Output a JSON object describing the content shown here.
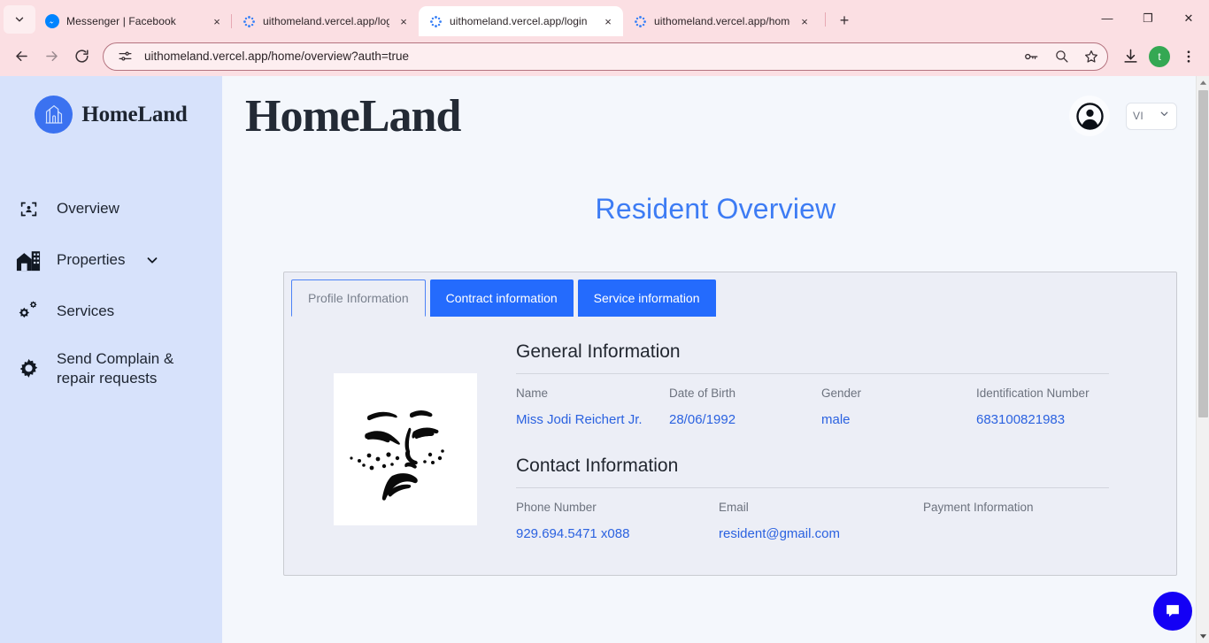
{
  "browser": {
    "tab_search_icon": "chevron-down-icon",
    "tabs": [
      {
        "title": "Messenger | Facebook",
        "favicon": "messenger-icon",
        "close": "×",
        "active": false
      },
      {
        "title": "uithomeland.vercel.app/login",
        "favicon": "vercel-app-icon",
        "close": "×",
        "active": false
      },
      {
        "title": "uithomeland.vercel.app/login",
        "favicon": "vercel-app-icon",
        "close": "×",
        "active": true
      },
      {
        "title": "uithomeland.vercel.app/home/c",
        "favicon": "vercel-app-icon",
        "close": "×",
        "active": false
      }
    ],
    "new_tab_label": "+",
    "window_controls": {
      "minimize": "—",
      "maximize": "❐",
      "close": "✕"
    },
    "toolbar": {
      "back_icon": "arrow-back-icon",
      "forward_icon": "arrow-forward-icon",
      "reload_icon": "reload-icon",
      "site_info_icon": "site-settings-icon",
      "url": "uithomeland.vercel.app/home/overview?auth=true",
      "password_icon": "password-key-icon",
      "zoom_icon": "zoom-search-icon",
      "bookmark_icon": "star-bookmark-icon",
      "download_icon": "download-icon",
      "profile_initial": "t",
      "menu_icon": "three-dot-menu-icon"
    }
  },
  "sidebar": {
    "brand": {
      "name": "HomeLand",
      "logo_icon": "homeland-building-logo"
    },
    "items": [
      {
        "label": "Overview",
        "icon": "overview-scan-icon",
        "has_chevron": false
      },
      {
        "label": "Properties",
        "icon": "properties-building-icon",
        "has_chevron": true,
        "chevron_icon": "chevron-down-icon"
      },
      {
        "label": "Services",
        "icon": "services-gears-icon",
        "has_chevron": false
      },
      {
        "label": "Send Complain & repair requests",
        "icon": "settings-gear-icon",
        "has_chevron": false
      }
    ]
  },
  "header": {
    "wordmark": "HomeLand",
    "account_icon": "account-circle-icon",
    "language": {
      "value": "VI",
      "chevron_icon": "chevron-down-icon"
    }
  },
  "main": {
    "page_title": "Resident Overview",
    "tabs": [
      {
        "label": "Profile Information",
        "active": true
      },
      {
        "label": "Contract information",
        "active": false
      },
      {
        "label": "Service information",
        "active": false
      }
    ],
    "photo_alt": "resident-face-illustration",
    "sections": [
      {
        "title": "General Information",
        "columns": 4,
        "fields": [
          {
            "label": "Name",
            "value": "Miss Jodi Reichert Jr."
          },
          {
            "label": "Date of Birth",
            "value": "28/06/1992"
          },
          {
            "label": "Gender",
            "value": "male"
          },
          {
            "label": "Identification Number",
            "value": "683100821983"
          }
        ]
      },
      {
        "title": "Contact Information",
        "columns": 3,
        "fields": [
          {
            "label": "Phone Number",
            "value": "929.694.5471 x088"
          },
          {
            "label": "Email",
            "value": "resident@gmail.com"
          },
          {
            "label": "Payment Information",
            "value": ""
          }
        ]
      }
    ],
    "chat_fab_icon": "chat-bubble-icon"
  },
  "colors": {
    "accent_blue": "#246bfd",
    "title_blue": "#3d7cf4",
    "value_blue": "#2b62e0",
    "sidebar_bg": "#d7e2fb",
    "page_bg": "#f4f7fc",
    "card_bg": "#eceef6",
    "fab_blue": "#1400f5",
    "chrome_pink": "#fbdfe3"
  }
}
